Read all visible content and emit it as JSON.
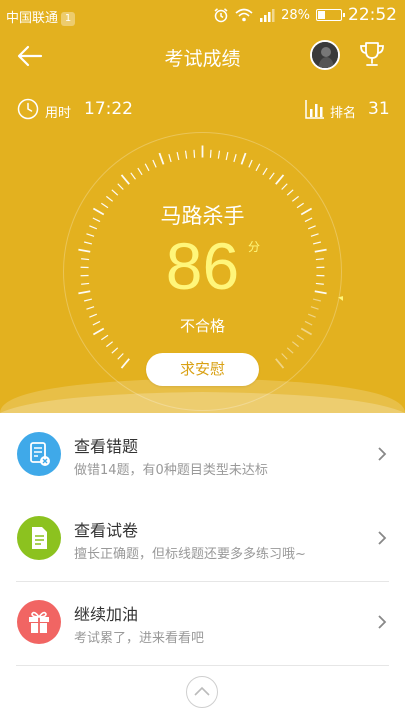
{
  "status_bar": {
    "carrier": "中国联通",
    "sim_badge": "1",
    "battery": "28%",
    "battery_level": 0.28,
    "time": "22:52"
  },
  "header": {
    "title": "考试成绩",
    "back_icon": "arrow-left-icon",
    "trophy_icon": "trophy-icon"
  },
  "stats": {
    "time_label": "用时",
    "time_value": "17:22",
    "rank_label": "排名",
    "rank_value": "31"
  },
  "score": {
    "title": "马路杀手",
    "value": "86",
    "unit": "分",
    "result": "不合格",
    "level": 0.86,
    "button_label": "求安慰"
  },
  "menu": [
    {
      "title": "查看错题",
      "subtitle": "做错14题，有0种题目类型未达标",
      "icon": "wrong-questions-icon",
      "color": "#3fa9e9"
    },
    {
      "title": "查看试卷",
      "subtitle": "擅长正确题，但标线题还要多多练习哦~",
      "icon": "exam-paper-icon",
      "color": "#8cc21f"
    },
    {
      "title": "继续加油",
      "subtitle": "考试累了，进来看看吧",
      "icon": "gift-icon",
      "color": "#f16563"
    }
  ],
  "colors": {
    "header_bg": "#e3b11f",
    "score_color": "#fff67a",
    "button_text": "#d9a114"
  }
}
